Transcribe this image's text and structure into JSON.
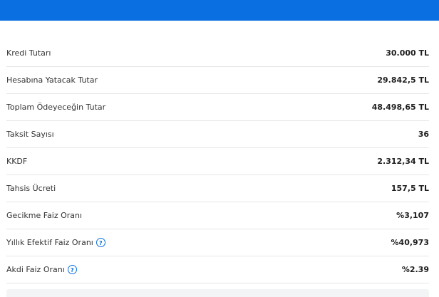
{
  "header": {
    "accent_color": "#0a6fe0"
  },
  "rows": [
    {
      "label": "Kredi Tutarı",
      "value": "30.000 TL",
      "has_help": false
    },
    {
      "label": "Hesabına Yatacak Tutar",
      "value": "29.842,5 TL",
      "has_help": false
    },
    {
      "label": "Toplam Ödeyeceğin Tutar",
      "value": "48.498,65 TL",
      "has_help": false
    },
    {
      "label": "Taksit Sayısı",
      "value": "36",
      "has_help": false
    },
    {
      "label": "KKDF",
      "value": "2.312,34 TL",
      "has_help": false
    },
    {
      "label": "Tahsis Ücreti",
      "value": "157,5 TL",
      "has_help": false
    },
    {
      "label": "Gecikme Faiz Oranı",
      "value": "%3,107",
      "has_help": false
    },
    {
      "label": "Yıllık Efektif Faiz Oranı",
      "value": "%40,973",
      "has_help": true,
      "help_icon": "question-circle-icon",
      "help_symbol": "?"
    },
    {
      "label": "Akdi Faiz Oranı",
      "value": "%2.39",
      "has_help": true,
      "help_icon": "question-circle-icon",
      "help_symbol": "?"
    }
  ]
}
